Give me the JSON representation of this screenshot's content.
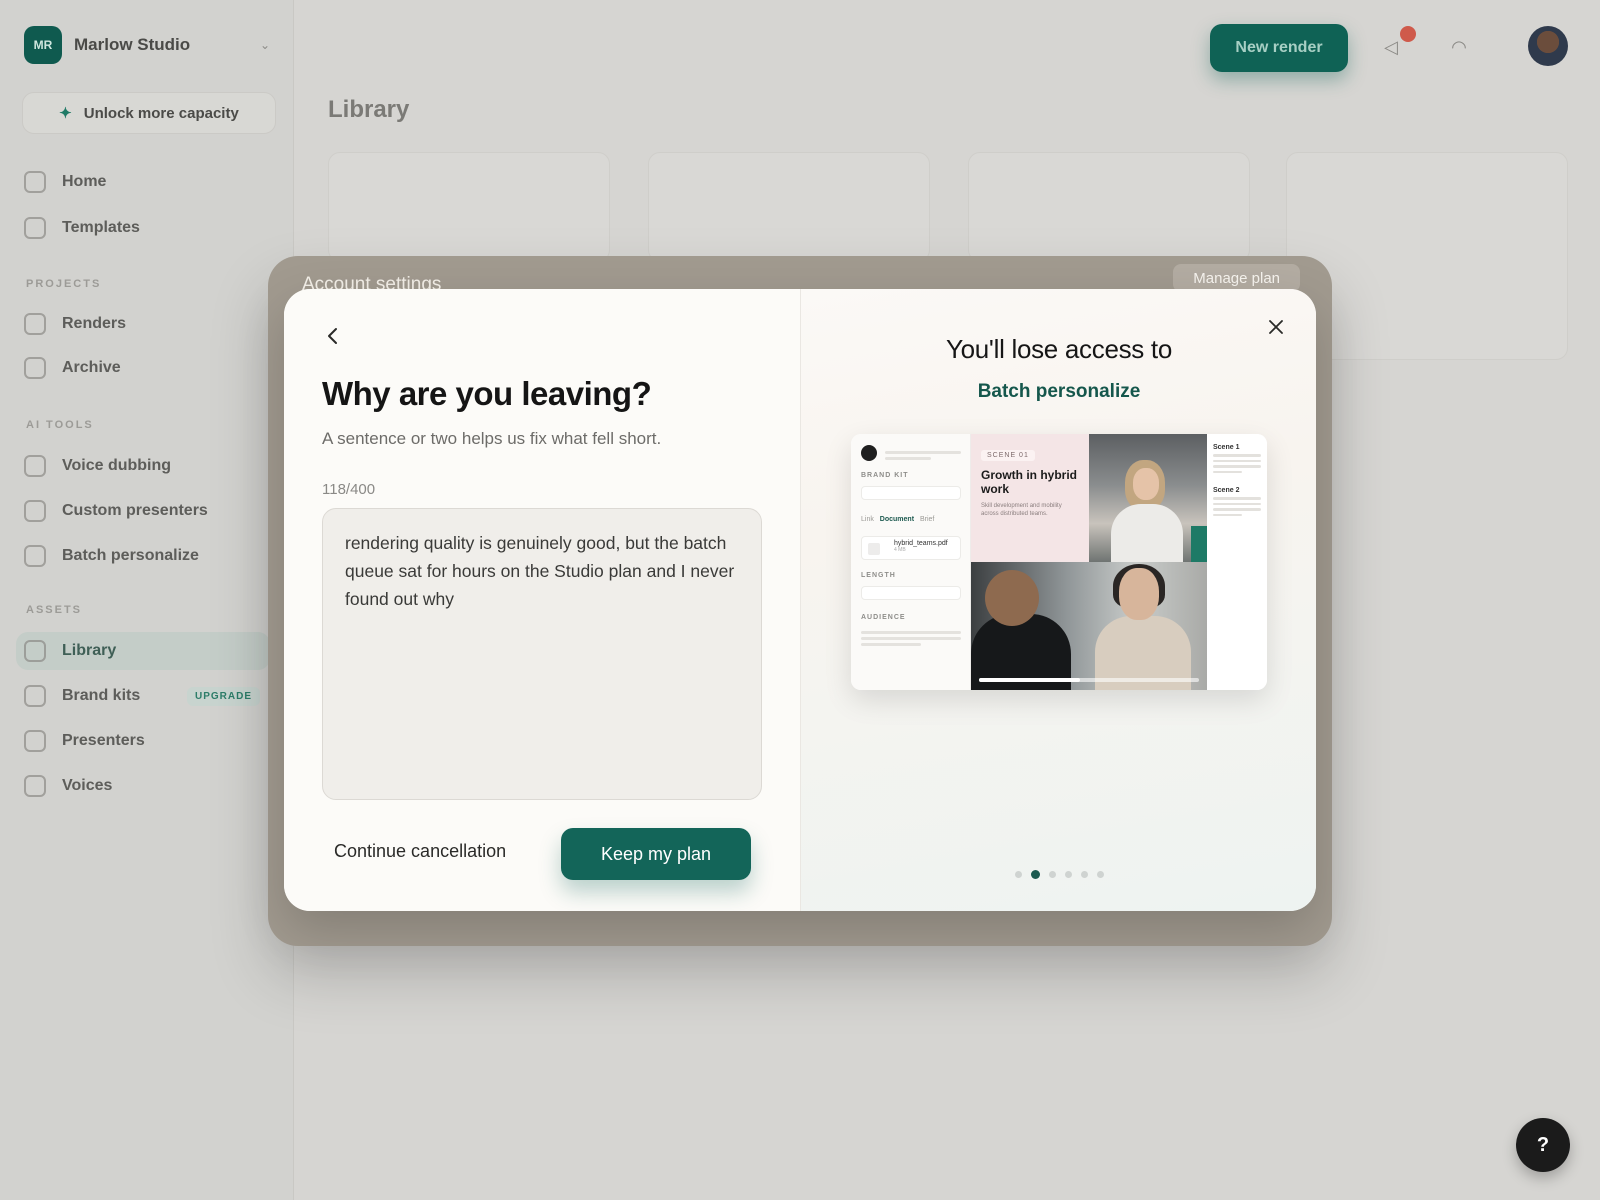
{
  "background": {
    "workspace": {
      "initials": "MR",
      "name": "Marlow Studio"
    },
    "unlock_label": "Unlock more capacity",
    "nav_top": [
      {
        "label": "Home"
      },
      {
        "label": "Templates"
      }
    ],
    "sections": {
      "projects": "PROJECTS",
      "ai_tools": "AI TOOLS",
      "assets": "ASSETS"
    },
    "nav_projects": [
      {
        "label": "Renders"
      },
      {
        "label": "Archive"
      }
    ],
    "nav_ai": [
      {
        "label": "Voice dubbing"
      },
      {
        "label": "Custom presenters"
      },
      {
        "label": "Batch personalize"
      }
    ],
    "nav_assets": [
      {
        "label": "Library",
        "active": true
      },
      {
        "label": "Brand kits",
        "badge": "UPGRADE"
      },
      {
        "label": "Presenters"
      },
      {
        "label": "Voices"
      }
    ],
    "new_render_label": "New render",
    "page_title": "Library"
  },
  "account_window": {
    "title": "Account settings",
    "manage_plan_label": "Manage plan"
  },
  "modal": {
    "title": "Why are you leaving?",
    "subtitle": "A sentence or two helps us fix what fell short.",
    "char_counter": "118/400",
    "feedback_text": "rendering quality is genuinely good, but the batch queue sat for hours on the Studio plan and I never found out why",
    "continue_label": "Continue cancellation",
    "keep_label": "Keep my plan",
    "lose_title": "You'll lose access to",
    "feature_name": "Batch personalize",
    "carousel": {
      "total": 6,
      "active_index": 1
    },
    "preview": {
      "brand_kit_label": "BRAND KIT",
      "tabs": [
        "Link",
        "Document",
        "Brief"
      ],
      "file_name": "hybrid_teams.pdf",
      "file_size": "4 MB",
      "length_label": "LENGTH",
      "audience_label": "AUDIENCE",
      "scene_tag": "SCENE 01",
      "scene_title": "Growth in hybrid work",
      "scene_desc": "Skill development and mobility across distributed teams.",
      "scene_list": [
        "Scene 1",
        "Scene 2"
      ]
    }
  },
  "help_label": "?",
  "colors": {
    "accent": "#136559",
    "feature_text": "#15574c",
    "notification": "#cf5a4b"
  }
}
